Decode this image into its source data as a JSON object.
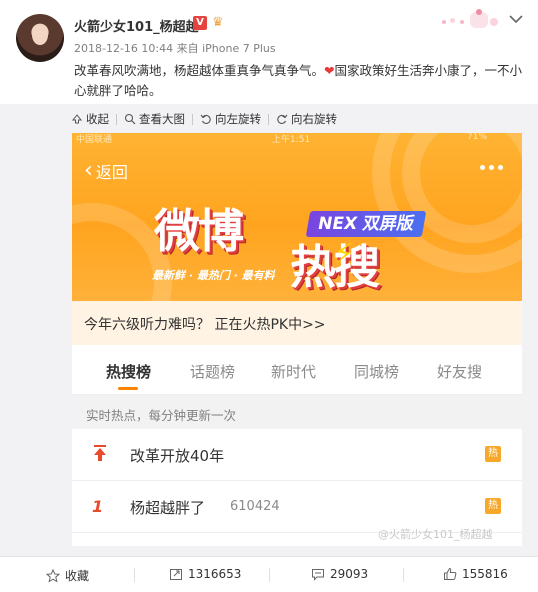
{
  "post": {
    "username": "火箭少女101_杨超越",
    "vip_badge": "V",
    "timestamp": "2018-12-16 10:44",
    "source": "来自 iPhone 7 Plus",
    "text_part1": "改革春风吹满地，杨超越体重真争气真争气。",
    "heart": "❤",
    "text_part2": "国家政策好生活奔小康了，一不小心就胖了哈哈。"
  },
  "toolbar": {
    "collapse": "收起",
    "view_large": "查看大图",
    "rotate_left": "向左旋转",
    "rotate_right": "向右旋转"
  },
  "screenshot": {
    "status_carrier": "中国联通",
    "status_time": "上午1:51",
    "status_battery": "71%",
    "back_label": "返回",
    "banner_title_1": "微博",
    "banner_title_2": "热搜",
    "nex_badge": "NEX 双屏版",
    "slogan": "最新鲜 · 最热门 · 最有料",
    "promo_text": "今年六级听力难吗？ 正在火热PK中>>",
    "tabs": [
      {
        "label": "热搜榜",
        "active": true
      },
      {
        "label": "话题榜"
      },
      {
        "label": "新时代"
      },
      {
        "label": "同城榜"
      },
      {
        "label": "好友搜"
      }
    ],
    "subhead": "实时热点，每分钟更新一次",
    "rows": [
      {
        "rank": "",
        "title": "改革开放40年",
        "count": "",
        "badge": "热"
      },
      {
        "rank": "1",
        "title": "杨超越胖了",
        "count": "610424",
        "badge": "热"
      }
    ],
    "watermark": "@火箭少女101_杨超越"
  },
  "footer": {
    "favorite": "收藏",
    "repost_count": "1316653",
    "comment_count": "29093",
    "like_count": "155816"
  },
  "colors": {
    "accent_orange": "#ff8200",
    "banner_orange": "#ffa41f",
    "hot_badge": "#f7a828",
    "heart_red": "#e6393a"
  }
}
